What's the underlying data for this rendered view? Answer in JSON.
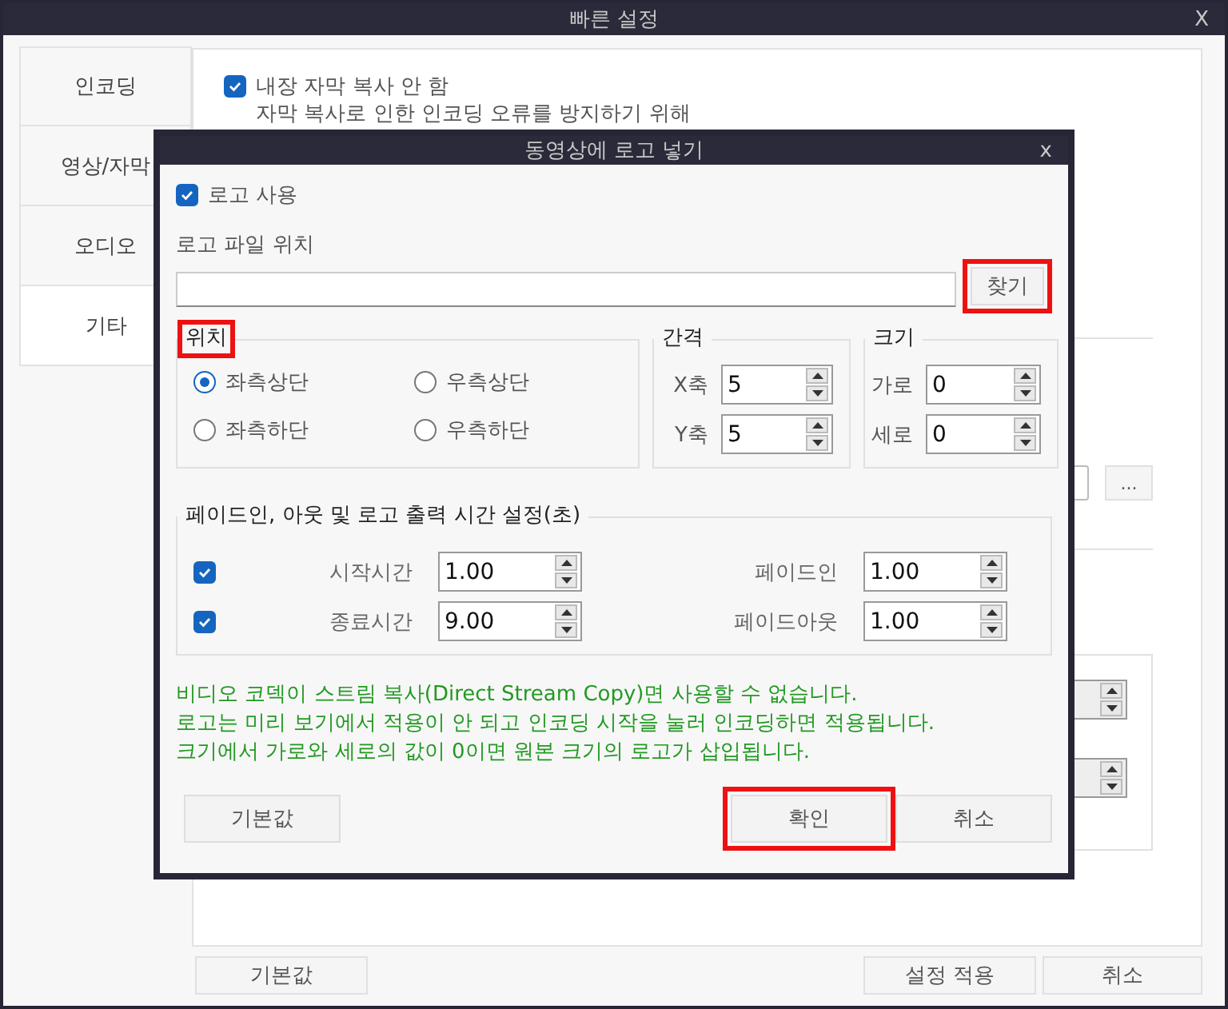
{
  "window": {
    "title": "빠른 설정",
    "close": "X"
  },
  "tabs": [
    {
      "label": "인코딩",
      "selected": false
    },
    {
      "label": "영상/자막",
      "selected": false
    },
    {
      "label": "오디오",
      "selected": false
    },
    {
      "label": "기타",
      "selected": true
    }
  ],
  "content": {
    "option": {
      "label": "내장 자막 복사 안 함",
      "checked": true
    },
    "description": "자막 복사로 인한 인코딩 오류를 방지하기 위해",
    "browse_button": "..."
  },
  "footer_buttons": [
    "기본값",
    "설정 적용",
    "취소"
  ],
  "dialog": {
    "title": "동영상에 로고 넣기",
    "close": "x",
    "use_logo": {
      "label": "로고 사용",
      "checked": true
    },
    "file_label": "로고 파일 위치",
    "browse": {
      "label": "찾기",
      "highlighted": true
    },
    "position": {
      "title": "위치",
      "highlighted": true,
      "options": [
        {
          "label": "좌측상단",
          "selected": true
        },
        {
          "label": "우측상단",
          "selected": false
        },
        {
          "label": "좌측하단",
          "selected": false
        },
        {
          "label": "우측하단",
          "selected": false
        }
      ]
    },
    "spacing": {
      "title": "간격",
      "fields": [
        {
          "label": "X축",
          "value": "5"
        },
        {
          "label": "Y축",
          "value": "5"
        }
      ]
    },
    "size": {
      "title": "크기",
      "fields": [
        {
          "label": "가로",
          "value": "0"
        },
        {
          "label": "세로",
          "value": "0"
        }
      ]
    },
    "timing": {
      "title": "페이드인, 아웃 및 로고 출력 시간 설정(초)",
      "rows": [
        {
          "checked": true,
          "label": "시작시간",
          "value": "1.00",
          "fade_label": "페이드인",
          "fade_value": "1.00"
        },
        {
          "checked": true,
          "label": "종료시간",
          "value": "9.00",
          "fade_label": "페이드아웃",
          "fade_value": "1.00"
        }
      ]
    },
    "notes": [
      "비디오 코덱이 스트림 복사(Direct Stream Copy)면 사용할 수 없습니다.",
      "로고는 미리 보기에서 적용이 안 되고 인코딩 시작을 눌러 인코딩하면 적용됩니다.",
      "크기에서 가로와 세로의 값이 0이면 원본 크기의 로고가 삽입됩니다."
    ],
    "buttons": [
      {
        "label": "기본값",
        "highlighted": false
      },
      {
        "label": "확인",
        "highlighted": true
      },
      {
        "label": "취소",
        "highlighted": false
      }
    ]
  }
}
